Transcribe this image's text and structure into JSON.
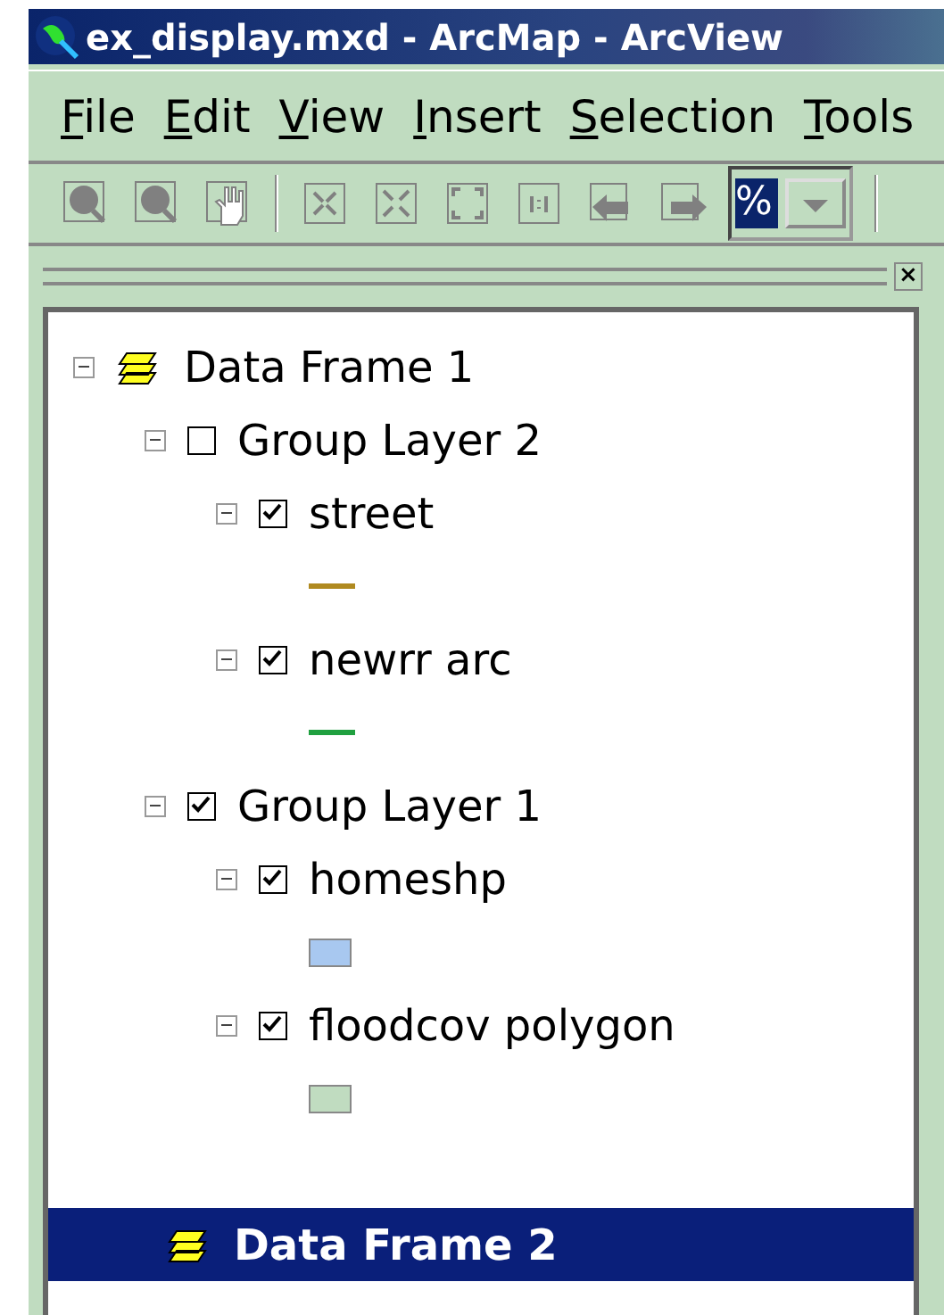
{
  "window": {
    "title": "ex_display.mxd - ArcMap - ArcView"
  },
  "menu": [
    "File",
    "Edit",
    "View",
    "Insert",
    "Selection",
    "Tools"
  ],
  "toolbar": {
    "scale_field": {
      "value": "%"
    }
  },
  "toc": {
    "close_button": "×",
    "items": [
      {
        "label": "Data Frame 1",
        "kind": "frame",
        "selected": false,
        "expanded": true,
        "children": [
          {
            "label": "Group Layer 2",
            "kind": "group",
            "selected": false,
            "expanded": true,
            "checked": false,
            "children": [
              {
                "label": "street",
                "kind": "layer",
                "selected": false,
                "expanded": true,
                "checked": true,
                "symbol": {
                  "kind": "line",
                  "color": "#b08a20"
                }
              },
              {
                "label": "newrr arc",
                "kind": "layer",
                "selected": false,
                "expanded": true,
                "checked": true,
                "symbol": {
                  "kind": "line",
                  "color": "#20a040"
                }
              }
            ]
          },
          {
            "label": "Group Layer 1",
            "kind": "group",
            "selected": false,
            "expanded": true,
            "checked": true,
            "children": [
              {
                "label": "homeshp",
                "kind": "layer",
                "selected": false,
                "expanded": true,
                "checked": true,
                "symbol": {
                  "kind": "fill",
                  "color": "#a8c8f0"
                }
              },
              {
                "label": "floodcov polygon",
                "kind": "layer",
                "selected": false,
                "expanded": true,
                "checked": true,
                "symbol": {
                  "kind": "fill",
                  "color": "#c0dcc0"
                }
              }
            ]
          }
        ]
      },
      {
        "label": "Data Frame 2",
        "kind": "frame",
        "selected": true
      }
    ]
  }
}
